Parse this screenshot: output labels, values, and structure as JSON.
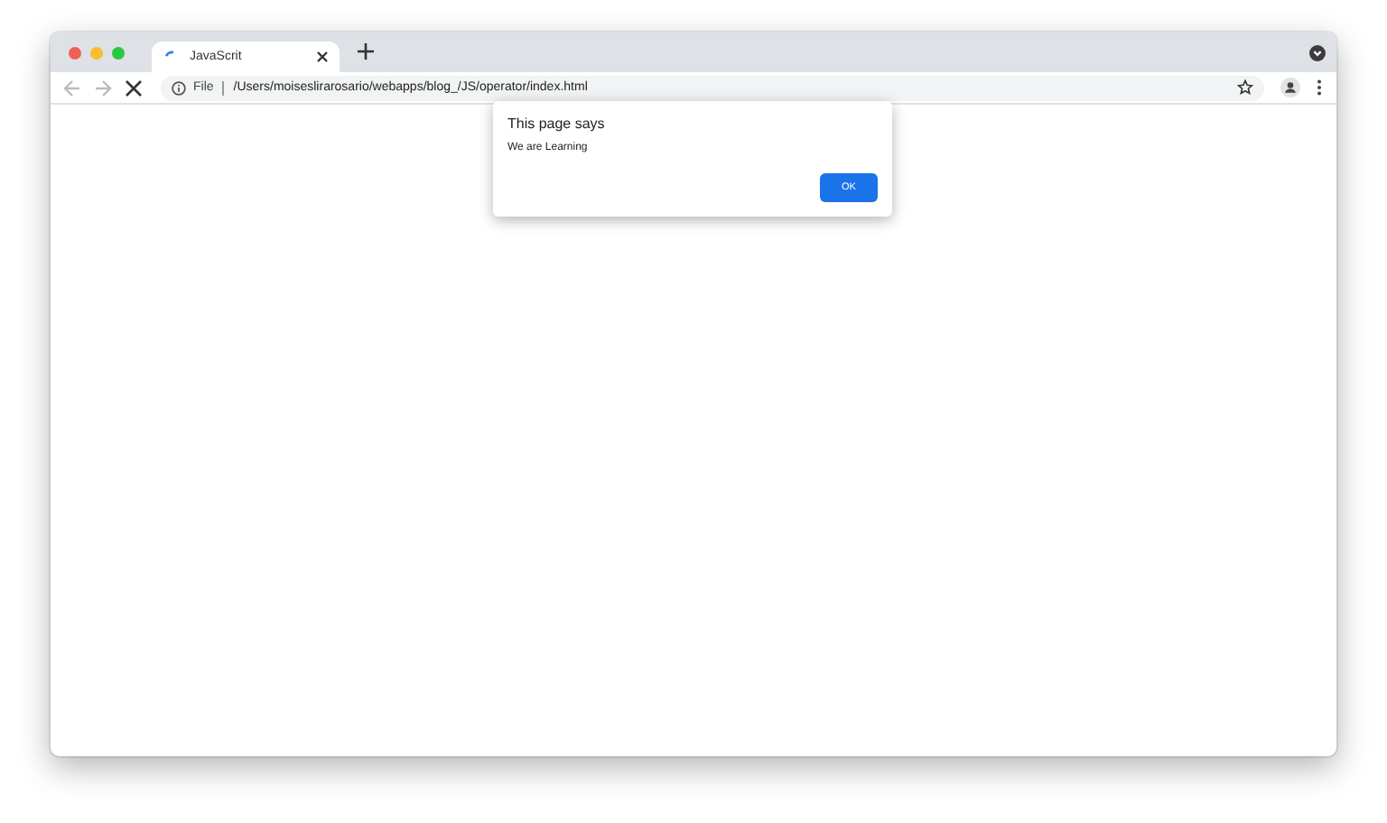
{
  "tabs": [
    {
      "title": "JavaScrit",
      "selected": true,
      "loading": true
    }
  ],
  "toolbar": {
    "back_disabled": true,
    "forward_disabled": true,
    "loading": true,
    "scheme": "File",
    "url": "/Users/moiseslirarosario/webapps/blog_/JS/operator/index.html"
  },
  "dialog": {
    "title": "This page says",
    "message": "We are Learning",
    "buttons": [
      "OK"
    ]
  }
}
